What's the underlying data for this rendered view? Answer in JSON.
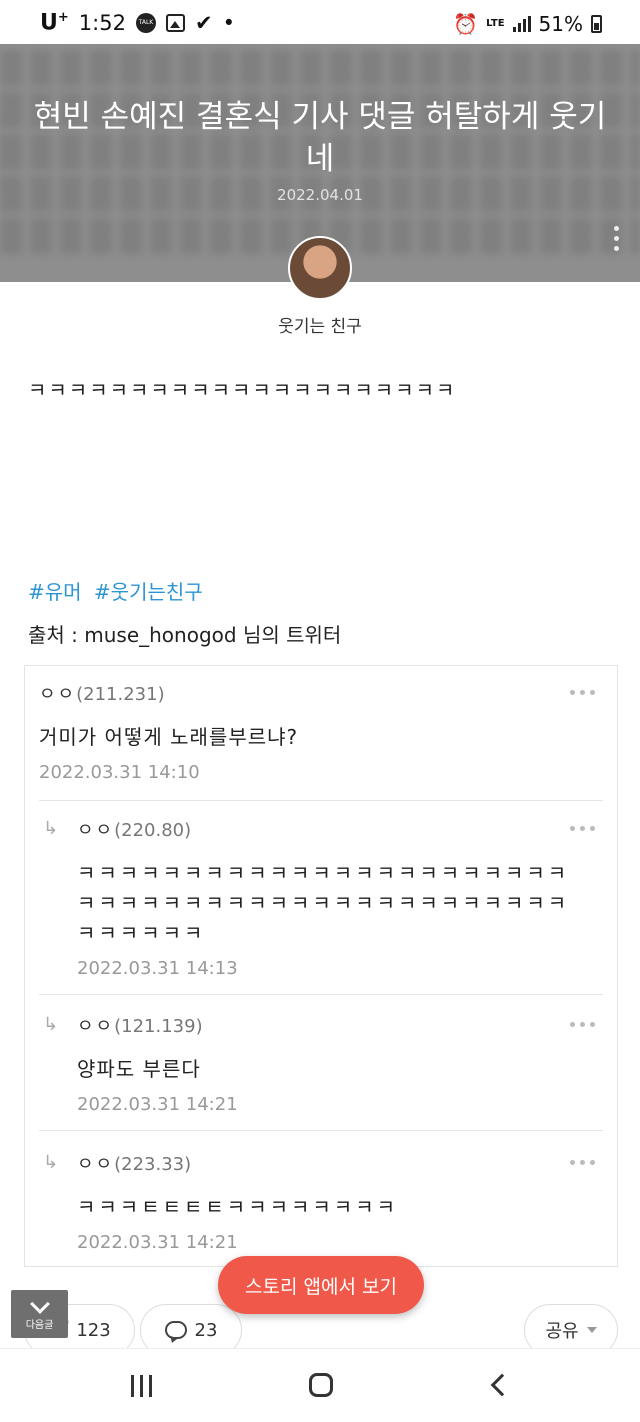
{
  "status_bar": {
    "carrier": "U",
    "carrier_sup": "+",
    "time": "1:52",
    "talk_badge": "TALK",
    "network": "LTE",
    "battery": "51%"
  },
  "post": {
    "title": "현빈 손예진 결혼식 기사 댓글 허탈하게 웃기네",
    "date": "2022.04.01",
    "author": "웃기는 친구",
    "body": "ㅋㅋㅋㅋㅋㅋㅋㅋㅋㅋㅋㅋㅋㅋㅋㅋㅋㅋㅋㅋㅋ",
    "tags": [
      "#유머",
      "#웃기는친구"
    ],
    "source": "출처 : muse_honogod 님의 트위터"
  },
  "comments": [
    {
      "name": "ㅇㅇ",
      "ip": "(211.231)",
      "text": "거미가 어떻게 노래를부르냐?",
      "time": "2022.03.31 14:10",
      "reply": false
    },
    {
      "name": "ㅇㅇ",
      "ip": "(220.80)",
      "text": "ㅋㅋㅋㅋㅋㅋㅋㅋㅋㅋㅋㅋㅋㅋㅋㅋㅋㅋㅋㅋㅋㅋㅋㅋㅋㅋㅋㅋㅋㅋㅋㅋㅋㅋㅋㅋㅋㅋㅋㅋㅋㅋㅋㅋㅋㅋㅋㅋㅋㅋㅋㅋ",
      "time": "2022.03.31 14:13",
      "reply": true
    },
    {
      "name": "ㅇㅇ",
      "ip": "(121.139)",
      "text": "양파도 부른다",
      "time": "2022.03.31 14:21",
      "reply": true
    },
    {
      "name": "ㅇㅇ",
      "ip": "(223.33)",
      "text": "ㅋㅋㅋㅌㅌㅌㅌㅋㅋㅋㅋㅋㅋㅋㅋ",
      "time": "2022.03.31 14:21",
      "reply": true
    }
  ],
  "reply_arrow": "↳",
  "actions": {
    "open_in_app": "스토리 앱에서 보기",
    "next_label": "다음글",
    "like_count": "123",
    "comment_count": "23",
    "share_label": "공유"
  }
}
